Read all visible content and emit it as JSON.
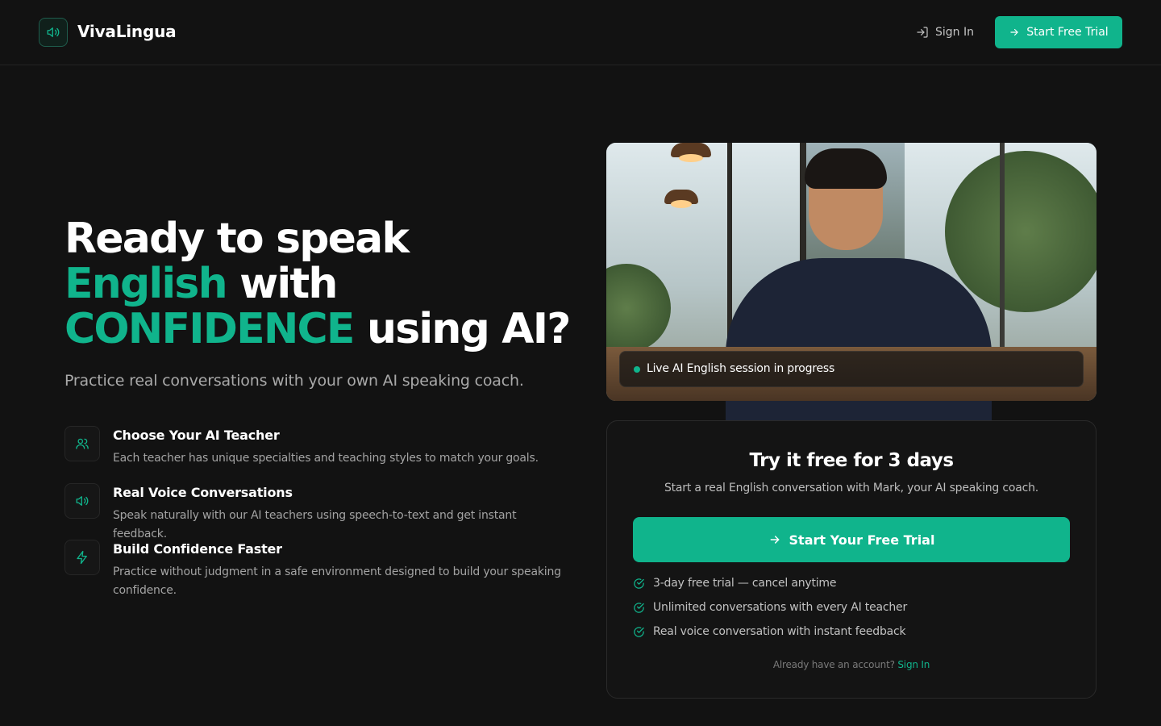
{
  "colors": {
    "background": "#121212",
    "accent": "#10b48c",
    "text_primary": "#ffffff",
    "text_muted": "#a9a9a9"
  },
  "header": {
    "brand_name": "VivaLingua",
    "logo_icon": "speaker-icon",
    "signin_label": "Sign In",
    "signin_icon": "login-icon",
    "trial_label": "Start Free Trial",
    "trial_icon": "arrow-right-icon"
  },
  "hero": {
    "headline_line1": "Ready to speak",
    "headline_accent1": "English",
    "headline_word_with": "with",
    "headline_accent2": "CONFIDENCE",
    "headline_end": "using AI?",
    "subtitle": "Practice real conversations with your own AI speaking coach."
  },
  "features": [
    {
      "icon": "users-icon",
      "title": "Choose Your AI Teacher",
      "description": "Each teacher has unique specialties and teaching styles to match your goals."
    },
    {
      "icon": "speaker-icon",
      "title": "Real Voice Conversations",
      "description": "Speak naturally with our AI teachers using speech-to-text and get instant feedback."
    },
    {
      "icon": "lightning-icon",
      "title": "Build Confidence Faster",
      "description": "Practice without judgment in a safe environment designed to build your speaking confidence."
    }
  ],
  "photo": {
    "live_status": "Live AI English session in progress"
  },
  "trial_card": {
    "title": "Try it free for 3 days",
    "subtitle": "Start a real English conversation with Mark, your AI speaking coach.",
    "button_label": "Start Your Free Trial",
    "benefits": [
      "3-day free trial — cancel anytime",
      "Unlimited conversations with every AI teacher",
      "Real voice conversation with instant feedback"
    ],
    "footer_text": "Already have an account?",
    "footer_link": "Sign In"
  }
}
